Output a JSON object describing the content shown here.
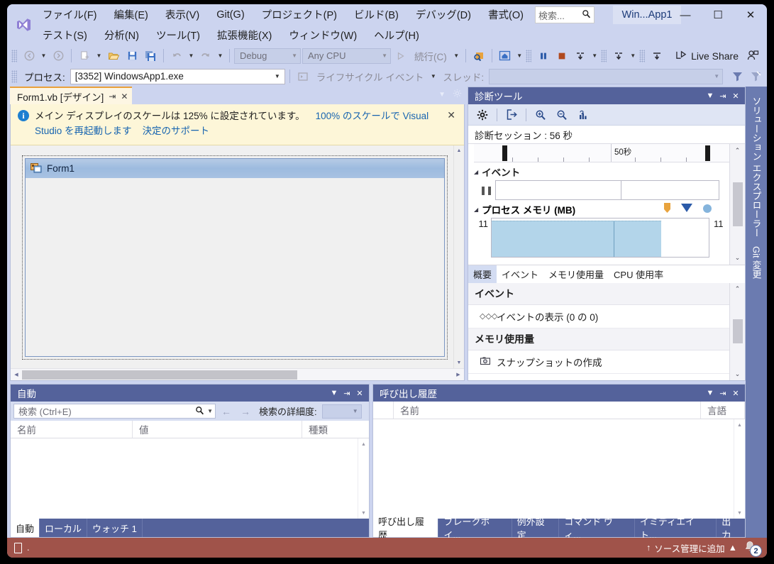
{
  "titlebar": {
    "logo_icon": "visual-studio-logo",
    "menus_row1": [
      "ファイル(F)",
      "編集(E)",
      "表示(V)",
      "Git(G)",
      "プロジェクト(P)",
      "ビルド(B)",
      "デバッグ(D)",
      "書式(O)"
    ],
    "menus_row2": [
      "テスト(S)",
      "分析(N)",
      "ツール(T)",
      "拡張機能(X)",
      "ウィンドウ(W)",
      "ヘルプ(H)"
    ],
    "search_placeholder": "検索...",
    "search_icon": "search-icon",
    "window_title": "Win...App1",
    "minimize": "—",
    "maximize": "☐",
    "close": "✕"
  },
  "toolbar": {
    "nav_back_icon": "navigate-back-icon",
    "nav_forward_icon": "navigate-forward-icon",
    "new_item_icon": "new-item-icon",
    "open_icon": "open-file-icon",
    "save_icon": "save-icon",
    "save_all_icon": "save-all-icon",
    "undo_icon": "undo-icon",
    "redo_icon": "redo-icon",
    "config_value": "Debug",
    "platform_value": "Any CPU",
    "continue_label": "続行(C)",
    "continue_icon": "play-icon",
    "step_find_icon": "quickwatch-icon",
    "home_icon": "hot-reload-icon",
    "pause_icon": "break-all-icon",
    "stop_icon": "stop-debugging-icon",
    "step_over_icon": "step-over-icon",
    "step_into_icon": "step-into-icon",
    "step_out_icon": "step-out-icon",
    "live_share_label": "Live Share",
    "live_share_icon": "live-share-icon",
    "account_icon": "account-manager-icon",
    "process_label": "プロセス:",
    "process_value": "[3352] WindowsApp1.exe",
    "lifecycle_label": "ライフサイクル イベント",
    "lifecycle_icon": "lifecycle-events-icon",
    "thread_label": "スレッド:",
    "thread_value": "",
    "filter_icon": "filter-icon",
    "filter_clear_icon": "clear-filter-icon"
  },
  "designer": {
    "tab_label": "Form1.vb [デザイン]",
    "tab_pin_icon": "pin-icon",
    "tab_close_icon": "close-icon",
    "tabstrip_dropdown_icon": "chevron-down-icon",
    "tabstrip_settings_icon": "gear-icon",
    "info_icon": "info-icon",
    "info_text_1": "メイン ディスプレイのスケールは 125% に設定されています。",
    "info_link_1": "100% のスケールで Visual Studio を再起動します",
    "info_link_2": "決定のサポート",
    "info_close_icon": "close-icon",
    "form_title": "Form1",
    "form_icon": "form-icon"
  },
  "diagnostics": {
    "title": "診断ツール",
    "title_dropdown_icon": "chevron-down-icon",
    "title_pin_icon": "pin-icon",
    "title_close_icon": "close-icon",
    "tool_settings_icon": "gear-icon",
    "tool_export_icon": "export-icon",
    "tool_zoom_in_icon": "zoom-in-icon",
    "tool_zoom_out_icon": "zoom-out-icon",
    "tool_chart_icon": "select-tools-icon",
    "scroll_up_icon": "chevron-up-icon",
    "scroll_down_icon": "chevron-down-icon",
    "session_label": "診断セッション : 56 秒",
    "ruler_label": "50秒",
    "events_label": "イベント",
    "events_icon": "pause-marker-icon",
    "memory_label": "プロセス メモリ (MB)",
    "legend_snapshot_icon": "snapshot-marker-icon",
    "legend_gc_icon": "gc-marker-icon",
    "legend_private_icon": "private-bytes-icon",
    "memory_axis_left": "11",
    "memory_axis_right": "11",
    "tabs": [
      {
        "label": "概要",
        "active": true
      },
      {
        "label": "イベント",
        "active": false
      },
      {
        "label": "メモリ使用量",
        "active": false
      },
      {
        "label": "CPU 使用率",
        "active": false
      }
    ],
    "list_section_events": "イベント",
    "list_item_events": "イベントの表示 (0 の 0)",
    "list_item_events_icon": "events-icon",
    "list_section_memory": "メモリ使用量",
    "list_item_snapshot": "スナップショットの作成",
    "list_item_snapshot_icon": "camera-icon"
  },
  "autos": {
    "title": "自動",
    "title_dropdown_icon": "chevron-down-icon",
    "title_pin_icon": "pin-icon",
    "title_close_icon": "close-icon",
    "search_placeholder": "検索 (Ctrl+E)",
    "search_icon": "search-icon",
    "search_dropdown_icon": "chevron-down-icon",
    "prev_icon": "arrow-left-icon",
    "next_icon": "arrow-right-icon",
    "depth_label": "検索の詳細度:",
    "depth_value": "",
    "columns": [
      "名前",
      "値",
      "種類"
    ],
    "rows": [],
    "tabs": [
      {
        "label": "自動",
        "active": true
      },
      {
        "label": "ローカル",
        "active": false
      },
      {
        "label": "ウォッチ 1",
        "active": false
      }
    ]
  },
  "callstack": {
    "title": "呼び出し履歴",
    "title_dropdown_icon": "chevron-down-icon",
    "title_pin_icon": "pin-icon",
    "title_close_icon": "close-icon",
    "columns": [
      "名前",
      "言語"
    ],
    "rows": [],
    "tabs": [
      {
        "label": "呼び出し履歴",
        "active": true
      },
      {
        "label": "ブレークポイ...",
        "active": false
      },
      {
        "label": "例外設定",
        "active": false
      },
      {
        "label": "コマンド ウィ...",
        "active": false
      },
      {
        "label": "イミディエイト...",
        "active": false
      },
      {
        "label": "出力",
        "active": false
      }
    ]
  },
  "right_rail": {
    "items": [
      "ソリューション エクスプローラー",
      "Git 変更"
    ]
  },
  "statusbar": {
    "status_icon": "ready-icon",
    "status_text": ".",
    "source_control_icon": "arrow-up-icon",
    "source_control_label": "ソース管理に追加",
    "source_control_caret": "▲",
    "bell_icon": "notifications-icon",
    "badge_count": "2"
  },
  "colors": {
    "accent_bar": "#a0534a",
    "title_bg": "#ccd4ef",
    "pane_header": "#54629b",
    "tab_accent": "#e9a13b",
    "info_bar": "#fdf6d8",
    "link": "#1764b0"
  }
}
